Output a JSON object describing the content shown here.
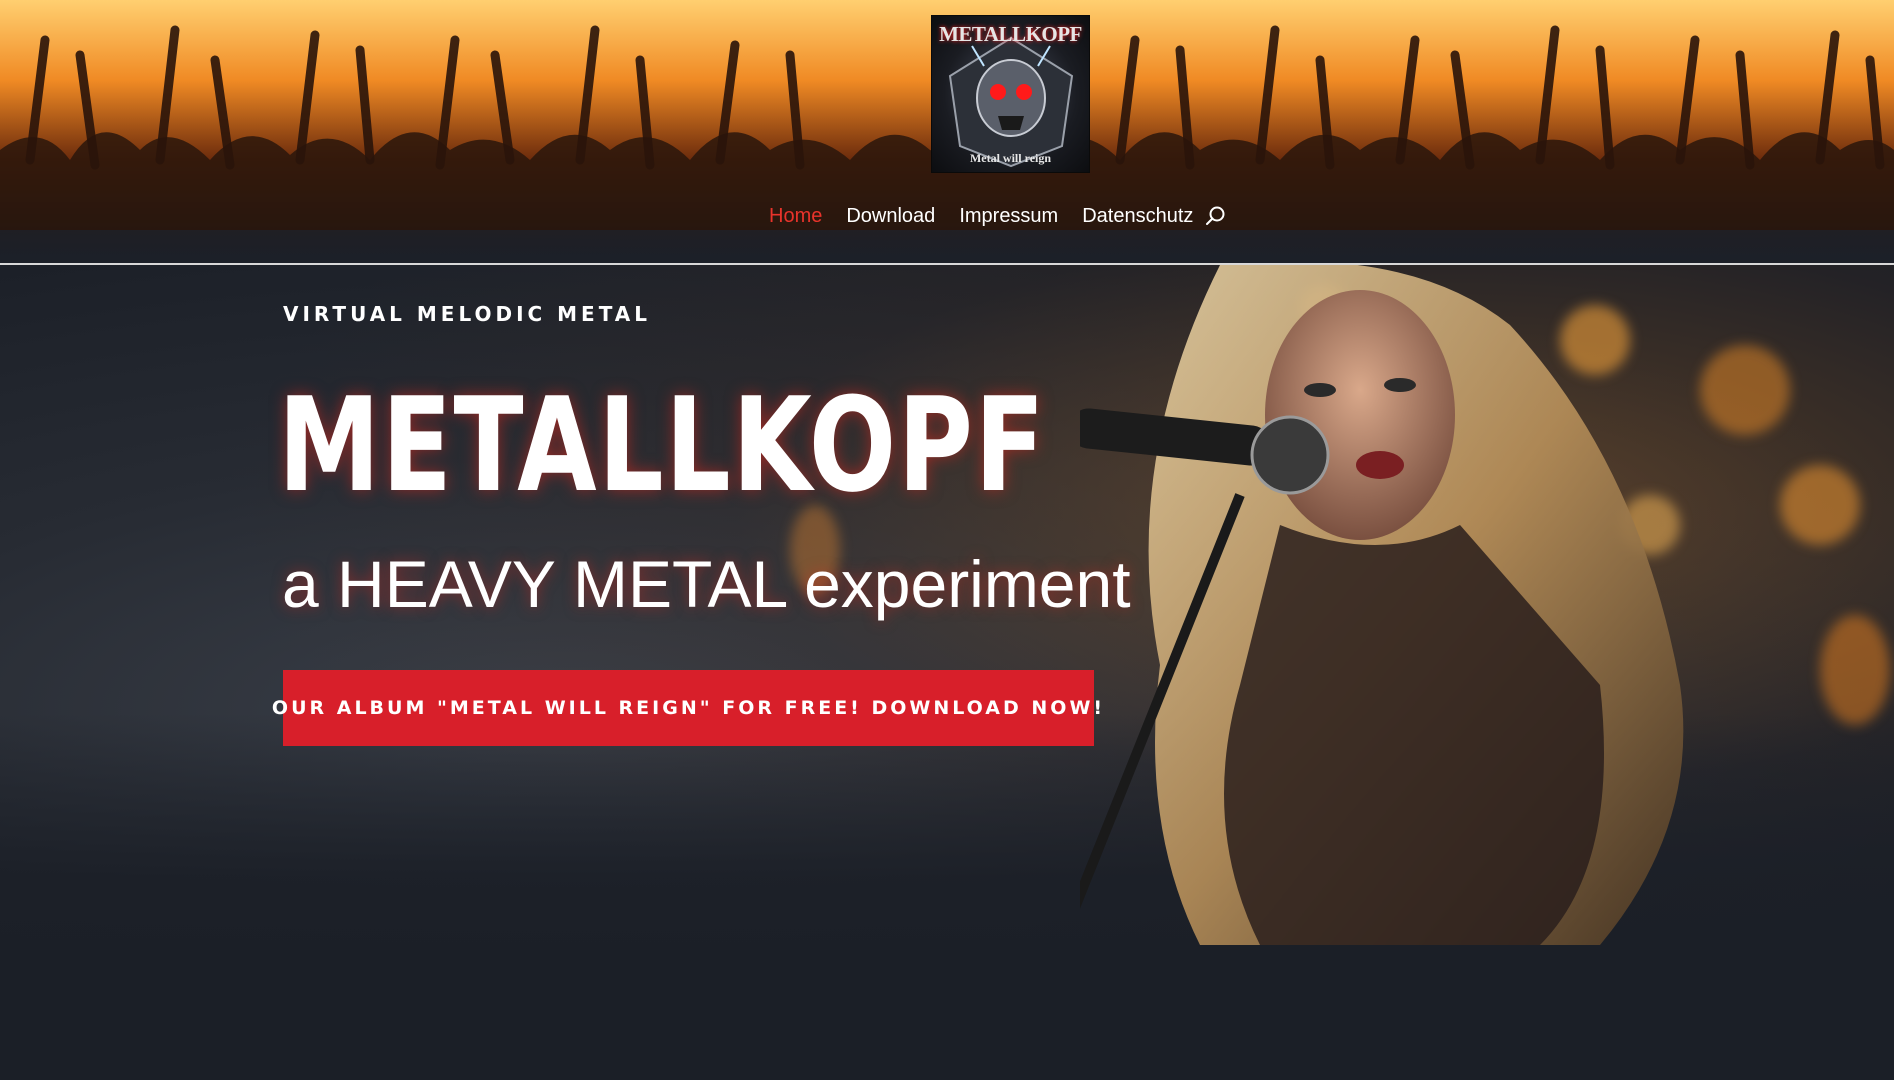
{
  "header": {
    "logo": {
      "title": "METALLKOPF",
      "subtitle": "Metal will reign",
      "icon": "skull-logo"
    },
    "nav": {
      "items": [
        {
          "label": "Home",
          "active": true
        },
        {
          "label": "Download",
          "active": false
        },
        {
          "label": "Impressum",
          "active": false
        },
        {
          "label": "Datenschutz",
          "active": false
        }
      ],
      "search_icon": "search-icon"
    }
  },
  "hero": {
    "eyebrow": "VIRTUAL MELODIC METAL",
    "title": "METALLKOPF",
    "subtitle": "a HEAVY METAL experiment",
    "cta_label": "OUR ALBUM \"METAL WILL REIGN\" FOR FREE! DOWNLOAD NOW!"
  },
  "colors": {
    "accent": "#e8332b",
    "button": "#d81f2a",
    "background": "#1b1f27"
  }
}
